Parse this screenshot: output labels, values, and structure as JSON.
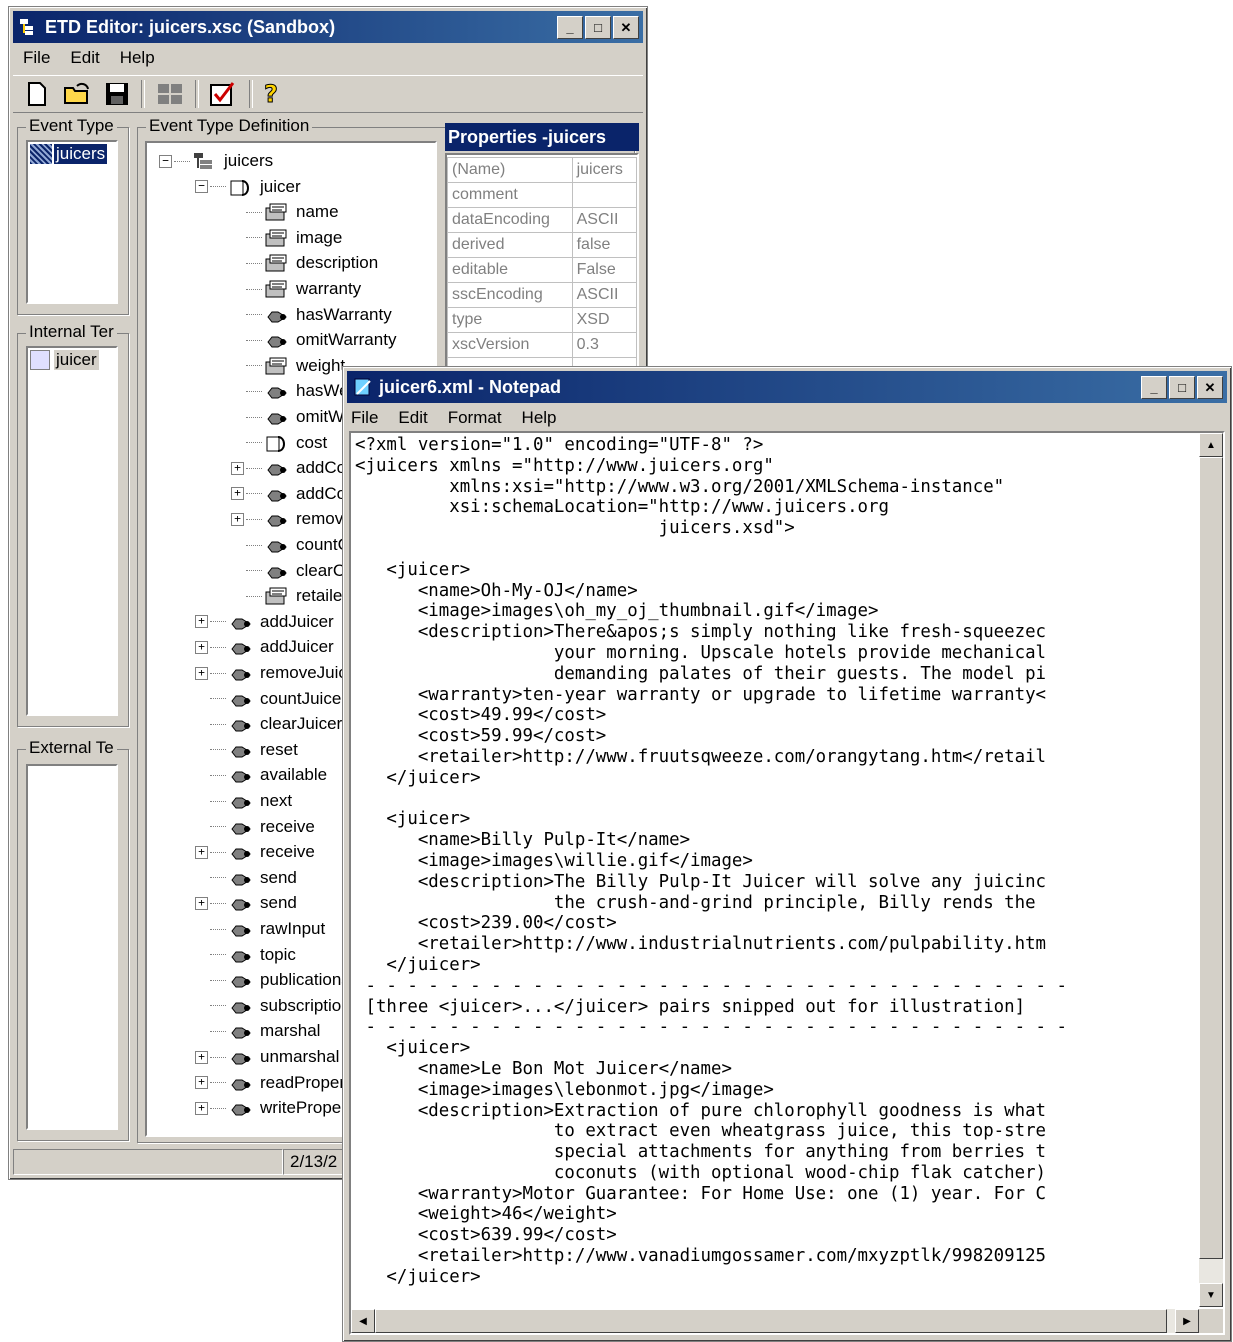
{
  "etd": {
    "title": "ETD Editor: juicers.xsc (Sandbox)",
    "menu": [
      "File",
      "Edit",
      "Help"
    ],
    "toolbar": [
      "new-icon",
      "open-icon",
      "save-icon",
      "grid-icon",
      "check-icon",
      "help-icon"
    ],
    "panels": {
      "event_type": {
        "label": "Event Type",
        "item": "juicers"
      },
      "definition": {
        "label": "Event Type Definition"
      },
      "internal": {
        "label": "Internal Ter",
        "item": "juicer"
      },
      "external": {
        "label": "External Te"
      }
    },
    "tree": [
      {
        "label": "juicers",
        "icon": "root-icon",
        "expander": "−"
      },
      {
        "label": "juicer",
        "icon": "node-icon",
        "expander": "−"
      },
      {
        "label": "name",
        "icon": "field-icon",
        "expander": ""
      },
      {
        "label": "image",
        "icon": "field-icon",
        "expander": ""
      },
      {
        "label": "description",
        "icon": "field-icon",
        "expander": ""
      },
      {
        "label": "warranty",
        "icon": "field-icon",
        "expander": ""
      },
      {
        "label": "hasWarranty",
        "icon": "method-icon",
        "expander": ""
      },
      {
        "label": "omitWarranty",
        "icon": "method-icon",
        "expander": ""
      },
      {
        "label": "weight",
        "icon": "field-icon",
        "expander": ""
      },
      {
        "label": "hasWe",
        "icon": "method-icon",
        "expander": ""
      },
      {
        "label": "omitWe",
        "icon": "method-icon",
        "expander": ""
      },
      {
        "label": "cost",
        "icon": "node-icon",
        "expander": ""
      },
      {
        "label": "addCos",
        "icon": "method-icon",
        "expander": "+"
      },
      {
        "label": "addCos",
        "icon": "method-icon",
        "expander": "+"
      },
      {
        "label": "remove",
        "icon": "method-icon",
        "expander": "+"
      },
      {
        "label": "countC",
        "icon": "method-icon",
        "expander": ""
      },
      {
        "label": "clearCo",
        "icon": "method-icon",
        "expander": ""
      },
      {
        "label": "retailer",
        "icon": "field-icon",
        "expander": ""
      },
      {
        "label": "addJuicer",
        "icon": "method-icon",
        "expander": "+"
      },
      {
        "label": "addJuicer",
        "icon": "method-icon",
        "expander": "+"
      },
      {
        "label": "removeJuic",
        "icon": "method-icon",
        "expander": "+"
      },
      {
        "label": "countJuicer",
        "icon": "method-icon",
        "expander": ""
      },
      {
        "label": "clearJuicer",
        "icon": "method-icon",
        "expander": ""
      },
      {
        "label": "reset",
        "icon": "method-icon",
        "expander": ""
      },
      {
        "label": "available",
        "icon": "method-icon",
        "expander": ""
      },
      {
        "label": "next",
        "icon": "method-icon",
        "expander": ""
      },
      {
        "label": "receive",
        "icon": "method-icon",
        "expander": ""
      },
      {
        "label": "receive",
        "icon": "method-icon",
        "expander": "+"
      },
      {
        "label": "send",
        "icon": "method-icon",
        "expander": ""
      },
      {
        "label": "send",
        "icon": "method-icon",
        "expander": "+"
      },
      {
        "label": "rawInput",
        "icon": "method-icon",
        "expander": ""
      },
      {
        "label": "topic",
        "icon": "method-icon",
        "expander": ""
      },
      {
        "label": "publications",
        "icon": "method-icon",
        "expander": ""
      },
      {
        "label": "subscription",
        "icon": "method-icon",
        "expander": ""
      },
      {
        "label": "marshal",
        "icon": "method-icon",
        "expander": ""
      },
      {
        "label": "unmarshal",
        "icon": "method-icon",
        "expander": "+"
      },
      {
        "label": "readPropert",
        "icon": "method-icon",
        "expander": "+"
      },
      {
        "label": "writePropert",
        "icon": "method-icon",
        "expander": "+"
      }
    ],
    "properties": {
      "title": "Properties -juicers",
      "rows": [
        [
          "(Name)",
          "juicers"
        ],
        [
          "comment",
          ""
        ],
        [
          "dataEncoding",
          "ASCII"
        ],
        [
          "derived",
          "false"
        ],
        [
          "editable",
          "False"
        ],
        [
          "sscEncoding",
          "ASCII"
        ],
        [
          "type",
          "XSD"
        ],
        [
          "xscVersion",
          "0.3"
        ]
      ]
    },
    "status": "2/13/2"
  },
  "notepad": {
    "title": "juicer6.xml - Notepad",
    "menu": [
      "File",
      "Edit",
      "Format",
      "Help"
    ],
    "lines": [
      "<?xml version=\"1.0\" encoding=\"UTF-8\" ?>",
      "<juicers xmlns =\"http://www.juicers.org\"",
      "         xmlns:xsi=\"http://www.w3.org/2001/XMLSchema-instance\"",
      "         xsi:schemaLocation=\"http://www.juicers.org",
      "                             juicers.xsd\">",
      "",
      "   <juicer>",
      "      <name>Oh-My-OJ</name>",
      "      <image>images\\oh_my_oj_thumbnail.gif</image>",
      "      <description>There&apos;s simply nothing like fresh-squeezec",
      "                   your morning. Upscale hotels provide mechanical",
      "                   demanding palates of their guests. The model pi",
      "      <warranty>ten-year warranty or upgrade to lifetime warranty<",
      "      <cost>49.99</cost>",
      "      <cost>59.99</cost>",
      "      <retailer>http://www.fruutsqweeze.com/orangytang.htm</retail",
      "   </juicer>",
      "",
      "   <juicer>",
      "      <name>Billy Pulp-It</name>",
      "      <image>images\\willie.gif</image>",
      "      <description>The Billy Pulp-It Juicer will solve any juicinc",
      "                   the crush-and-grind principle, Billy rends the",
      "      <cost>239.00</cost>",
      "      <retailer>http://www.industrialnutrients.com/pulpability.htm",
      "   </juicer>",
      " - - - - - - - - - - - - - - - - - - - - - - - - - - - - - - - - - -",
      " [three <juicer>...</juicer> pairs snipped out for illustration]",
      " - - - - - - - - - - - - - - - - - - - - - - - - - - - - - - - - - -",
      "   <juicer>",
      "      <name>Le Bon Mot Juicer</name>",
      "      <image>images\\lebonmot.jpg</image>",
      "      <description>Extraction of pure chlorophyll goodness is what",
      "                   to extract even wheatgrass juice, this top-stre",
      "                   special attachments for anything from berries t",
      "                   coconuts (with optional wood-chip flak catcher)",
      "      <warranty>Motor Guarantee: For Home Use: one (1) year. For C",
      "      <weight>46</weight>",
      "      <cost>639.99</cost>",
      "      <retailer>http://www.vanadiumgossamer.com/mxyzptlk/998209125",
      "   </juicer>"
    ]
  },
  "colors": {
    "title_active": "#0a246a",
    "face": "#d4d0c8"
  }
}
